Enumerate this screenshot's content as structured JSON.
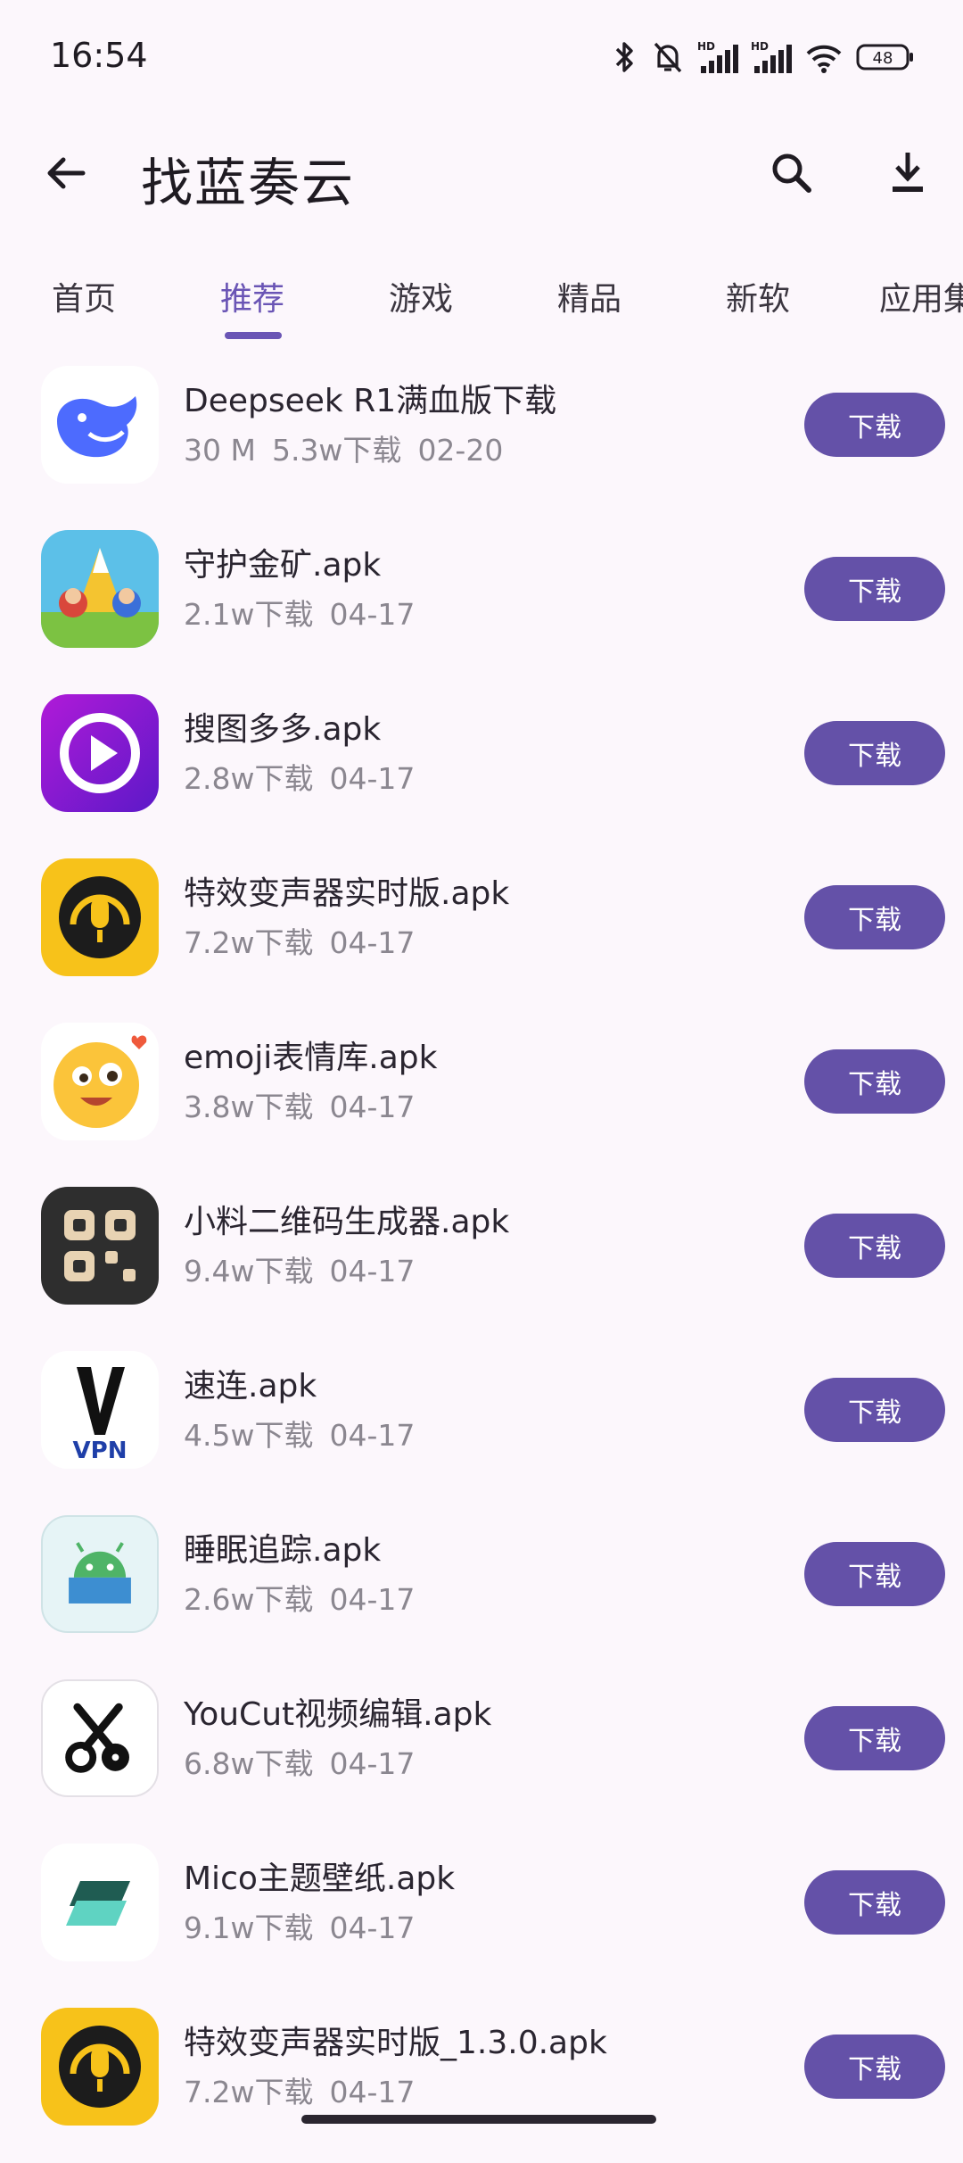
{
  "status": {
    "time": "16:54",
    "hd1": "HD",
    "hd2": "HD",
    "battery": "48"
  },
  "appbar": {
    "title": "找蓝奏云",
    "back_icon": "arrow-back-icon",
    "search_icon": "search-icon",
    "download_icon": "download-icon"
  },
  "tabs": [
    {
      "label": "首页"
    },
    {
      "label": "推荐"
    },
    {
      "label": "游戏"
    },
    {
      "label": "精品"
    },
    {
      "label": "新软"
    },
    {
      "label": "应用集"
    }
  ],
  "active_tab": "推荐",
  "colors": {
    "accent": "#6a55b5",
    "button": "#6451a8",
    "background": "#fcf7fc"
  },
  "items": [
    {
      "name": "Deepseek R1满血版下载",
      "size": "30 M",
      "downloads": "5.3w下载",
      "date": "02-20",
      "button": "下载",
      "icon": "deepseek-whale-icon"
    },
    {
      "name": "守护金矿.apk",
      "size": "",
      "downloads": "2.1w下载",
      "date": "04-17",
      "button": "下载",
      "icon": "guard-gold-mine-icon"
    },
    {
      "name": "搜图多多.apk",
      "size": "",
      "downloads": "2.8w下载",
      "date": "04-17",
      "button": "下载",
      "icon": "play-triangle-icon"
    },
    {
      "name": "特效变声器实时版.apk",
      "size": "",
      "downloads": "7.2w下载",
      "date": "04-17",
      "button": "下载",
      "icon": "microphone-headphones-icon"
    },
    {
      "name": "emoji表情库.apk",
      "size": "",
      "downloads": "3.8w下载",
      "date": "04-17",
      "button": "下载",
      "icon": "emoji-face-icon"
    },
    {
      "name": "小料二维码生成器.apk",
      "size": "",
      "downloads": "9.4w下载",
      "date": "04-17",
      "button": "下载",
      "icon": "qr-code-icon"
    },
    {
      "name": "速连.apk",
      "size": "",
      "downloads": "4.5w下载",
      "date": "04-17",
      "button": "下载",
      "icon": "vpn-icon"
    },
    {
      "name": "睡眠追踪.apk",
      "size": "",
      "downloads": "2.6w下载",
      "date": "04-17",
      "button": "下载",
      "icon": "sleeping-android-icon"
    },
    {
      "name": "YouCut视频编辑.apk",
      "size": "",
      "downloads": "6.8w下载",
      "date": "04-17",
      "button": "下载",
      "icon": "scissors-film-icon"
    },
    {
      "name": "Mico主题壁纸.apk",
      "size": "",
      "downloads": "9.1w下载",
      "date": "04-17",
      "button": "下载",
      "icon": "layered-tiles-icon"
    },
    {
      "name": "特效变声器实时版_1.3.0.apk",
      "size": "",
      "downloads": "7.2w下载",
      "date": "04-17",
      "button": "下载",
      "icon": "microphone-headphones-icon"
    }
  ]
}
